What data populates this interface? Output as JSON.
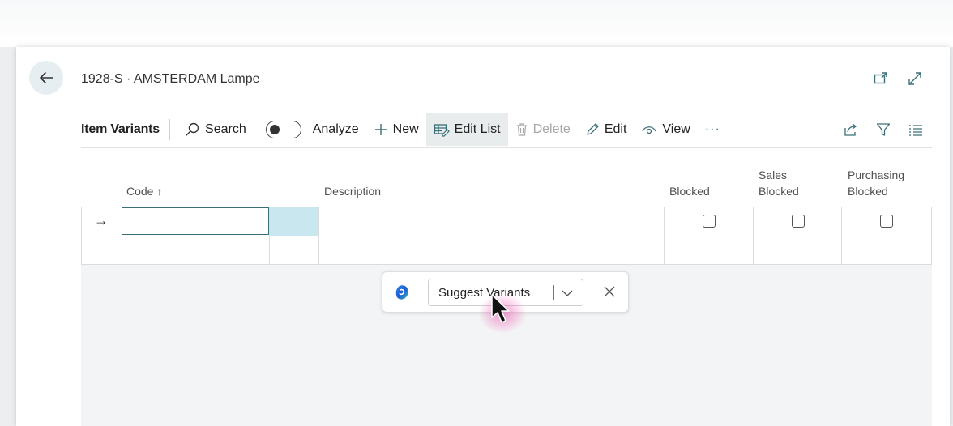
{
  "page": {
    "title": "1928-S · AMSTERDAM Lampe"
  },
  "actionbar": {
    "title": "Item Variants",
    "search": "Search",
    "analyze": "Analyze",
    "new": "New",
    "edit_list": "Edit List",
    "delete": "Delete",
    "edit": "Edit",
    "view": "View",
    "more": "···"
  },
  "grid": {
    "columns": {
      "code": "Code ↑",
      "description": "Description",
      "blocked": "Blocked",
      "sales_blocked_1": "Sales",
      "sales_blocked_2": "Blocked",
      "purchasing_blocked_1": "Purchasing",
      "purchasing_blocked_2": "Blocked"
    },
    "rows": [
      {
        "code": "",
        "description": "",
        "blocked": false,
        "sales_blocked": false,
        "purchasing_blocked": false
      }
    ],
    "row_marker": "→"
  },
  "copilot": {
    "suggest_label": "Suggest Variants",
    "icons": [
      "copilot-icon",
      "chevron-down-icon",
      "close-icon"
    ]
  },
  "colors": {
    "accent_teal": "#3a6f76",
    "selected_cell": "#c8e7ee",
    "active_action_bg": "#e9eced"
  }
}
